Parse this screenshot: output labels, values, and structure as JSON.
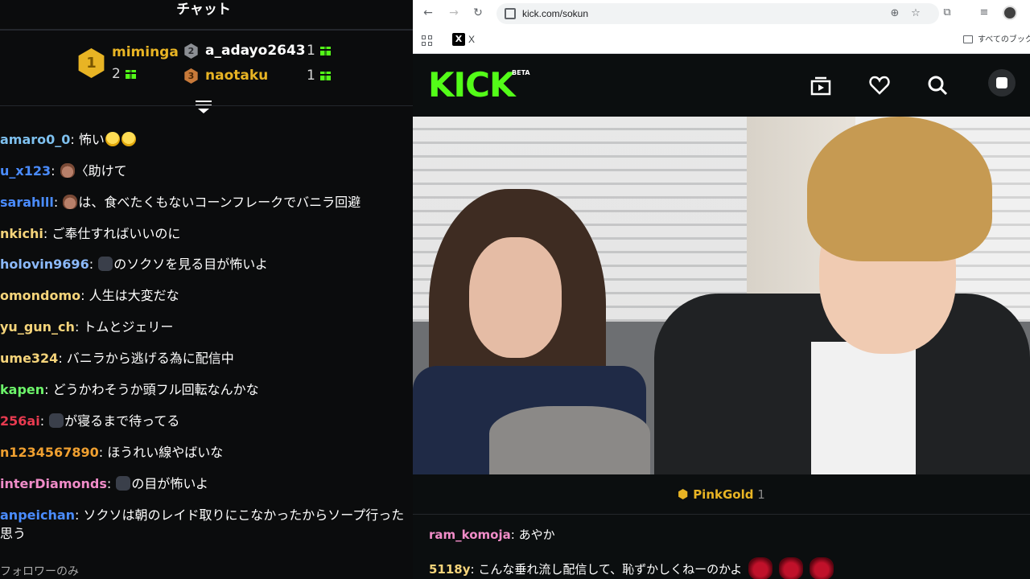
{
  "chat": {
    "title": "チャット",
    "leaderboard": [
      {
        "rank": "1",
        "name": "miminga",
        "count": "2",
        "color": "#e8b424"
      },
      {
        "rank": "2",
        "name": "a_adayo2643",
        "count": "1",
        "color": "#ffffff"
      },
      {
        "rank": "3",
        "name": "naotaku",
        "count": "1",
        "color": "#e8b424"
      }
    ],
    "messages": [
      {
        "user": "amaro0_0",
        "color": "#7ec0ee",
        "text": "怖い",
        "emotes": [
          "scream",
          "scream"
        ]
      },
      {
        "user": "u_x123",
        "color": "#4a8cff",
        "text": "〈助けて",
        "emotes_before": [
          "poop"
        ]
      },
      {
        "user": "sarahlll",
        "color": "#4a8cff",
        "text": "は、食べたくもないコーンフレークでバニラ回避",
        "emotes_before": [
          "poop"
        ]
      },
      {
        "user": "nkichi",
        "color": "#f5d47a",
        "text": "ご奉仕すればいいのに"
      },
      {
        "user": "holovin9696",
        "color": "#8bb8f8",
        "text": "のソクソを見る目が怖いよ",
        "emotes_before": [
          "goat"
        ]
      },
      {
        "user": "omondomo",
        "color": "#f5d47a",
        "text": "人生は大変だな"
      },
      {
        "user": "yu_gun_ch",
        "color": "#f5d47a",
        "text": "トムとジェリー"
      },
      {
        "user": "ume324",
        "color": "#f5d47a",
        "text": "バニラから逃げる為に配信中"
      },
      {
        "user": "kapen",
        "color": "#6df56a",
        "text": "どうかわそうか頭フル回転なんかな"
      },
      {
        "user": "256ai",
        "color": "#e83b50",
        "text": "が寝るまで待ってる",
        "emotes_before": [
          "goat"
        ]
      },
      {
        "user": "n1234567890",
        "color": "#f0a030",
        "text": "ほうれい線やばいな"
      },
      {
        "user": "interDiamonds",
        "color": "#f08cc8",
        "text": "の目が怖いよ",
        "emotes_before": [
          "goat"
        ]
      },
      {
        "user": "anpeichan",
        "color": "#4a8cff",
        "text": "ソクソは朝のレイド取りにこなかったからソープ行った",
        "text2": "思う"
      }
    ],
    "follower_note": "フォロワーのみ"
  },
  "browser": {
    "url": "kick.com/sokun",
    "bookmark_x_label": "X",
    "bookmarks_folder_label": "すべてのブックマ"
  },
  "kick": {
    "logo": "KICK",
    "beta": "BETA",
    "brand_color": "#53fc18"
  },
  "stream_chat": {
    "pinned_user": "PinkGold",
    "pinned_count": "1",
    "messages": [
      {
        "user": "ram_komoja",
        "color": "#f08cc8",
        "text": "あやか"
      },
      {
        "user": "5118y",
        "color": "#f5d47a",
        "text": "こんな垂れ流し配信して、恥ずかしくねーのかよ"
      }
    ]
  }
}
